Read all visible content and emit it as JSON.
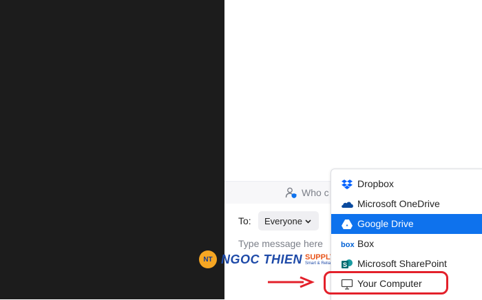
{
  "chat": {
    "who_text": "Who c",
    "to_label": "To:",
    "recipient": "Everyone",
    "message_placeholder": "Type message here"
  },
  "watermark": {
    "badge": "NT",
    "name": "NGOC THIEN",
    "supply": "SUPPLY",
    "tagline": "Smart & Reliable"
  },
  "menu": {
    "items": [
      {
        "label": "Dropbox",
        "icon": "dropbox-icon"
      },
      {
        "label": "Microsoft OneDrive",
        "icon": "onedrive-icon"
      },
      {
        "label": "Google Drive",
        "icon": "google-drive-icon",
        "selected": true
      },
      {
        "label": "Box",
        "icon": "box-icon"
      },
      {
        "label": "Microsoft SharePoint",
        "icon": "sharepoint-icon"
      },
      {
        "label": "Your Computer",
        "icon": "monitor-icon"
      }
    ]
  },
  "colors": {
    "accent": "#0e72ed",
    "highlight": "#e3202a",
    "dark_bg": "#1c1c1c"
  }
}
